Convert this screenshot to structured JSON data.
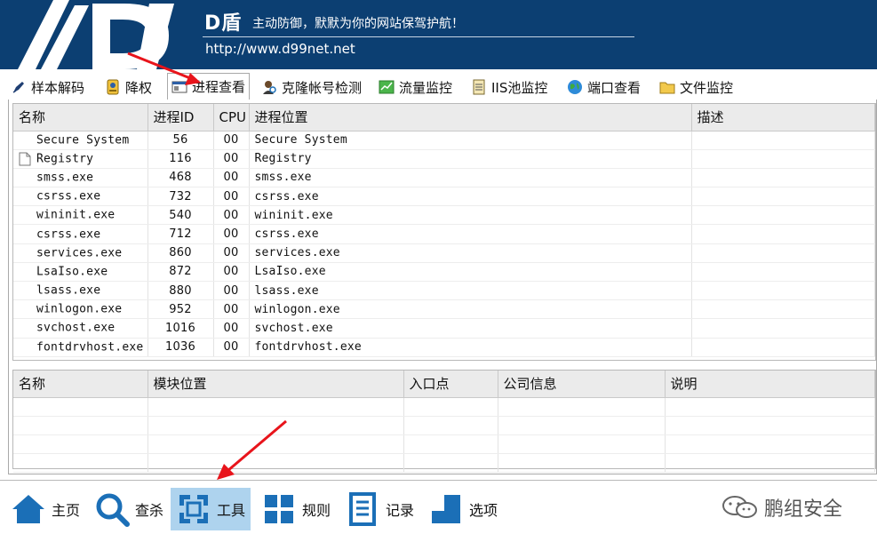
{
  "header": {
    "brand": "D盾",
    "tagline": "主动防御，默默为你的网站保驾护航！",
    "url": "http://www.d99net.net"
  },
  "tabs": [
    {
      "label": "样本解码",
      "icon": "pen-icon"
    },
    {
      "label": "降权",
      "icon": "badge-icon"
    },
    {
      "label": "进程查看",
      "icon": "process-window-icon",
      "active": true
    },
    {
      "label": "克隆帐号检测",
      "icon": "user-detect-icon"
    },
    {
      "label": "流量监控",
      "icon": "traffic-chart-icon"
    },
    {
      "label": "IIS池监控",
      "icon": "document-list-icon"
    },
    {
      "label": "端口查看",
      "icon": "globe-icon"
    },
    {
      "label": "文件监控",
      "icon": "folder-icon"
    }
  ],
  "process_table": {
    "columns": [
      "名称",
      "进程ID",
      "CPU",
      "进程位置",
      "描述"
    ],
    "rows": [
      {
        "name": "Secure System",
        "pid": "56",
        "cpu": "00",
        "path": "Secure System",
        "desc": ""
      },
      {
        "name": "Registry",
        "pid": "116",
        "cpu": "00",
        "path": "Registry",
        "desc": ""
      },
      {
        "name": "smss.exe",
        "pid": "468",
        "cpu": "00",
        "path": "smss.exe",
        "desc": ""
      },
      {
        "name": "csrss.exe",
        "pid": "732",
        "cpu": "00",
        "path": "csrss.exe",
        "desc": ""
      },
      {
        "name": "wininit.exe",
        "pid": "540",
        "cpu": "00",
        "path": "wininit.exe",
        "desc": ""
      },
      {
        "name": "csrss.exe",
        "pid": "712",
        "cpu": "00",
        "path": "csrss.exe",
        "desc": ""
      },
      {
        "name": "services.exe",
        "pid": "860",
        "cpu": "00",
        "path": "services.exe",
        "desc": ""
      },
      {
        "name": "LsaIso.exe",
        "pid": "872",
        "cpu": "00",
        "path": "LsaIso.exe",
        "desc": ""
      },
      {
        "name": "lsass.exe",
        "pid": "880",
        "cpu": "00",
        "path": "lsass.exe",
        "desc": ""
      },
      {
        "name": "winlogon.exe",
        "pid": "952",
        "cpu": "00",
        "path": "winlogon.exe",
        "desc": ""
      },
      {
        "name": "svchost.exe",
        "pid": "1016",
        "cpu": "00",
        "path": "svchost.exe",
        "desc": ""
      },
      {
        "name": "fontdrvhost.exe",
        "pid": "1036",
        "cpu": "00",
        "path": "fontdrvhost.exe",
        "desc": ""
      }
    ]
  },
  "module_table": {
    "columns": [
      "名称",
      "模块位置",
      "入口点",
      "公司信息",
      "说明"
    ],
    "empty_rows": 4
  },
  "bottom_nav": [
    {
      "label": "主页",
      "icon": "home-icon"
    },
    {
      "label": "查杀",
      "icon": "search-icon"
    },
    {
      "label": "工具",
      "icon": "tools-icon",
      "active": true
    },
    {
      "label": "规则",
      "icon": "rules-grid-icon"
    },
    {
      "label": "记录",
      "icon": "log-list-icon"
    },
    {
      "label": "选项",
      "icon": "options-icon"
    }
  ],
  "watermark": {
    "text": "鹏组安全",
    "icon": "wechat-icon"
  },
  "colors": {
    "header_bg": "#0c3f72",
    "active_nav": "#aed3ee",
    "nav_icon": "#1b6fb7",
    "annotation_arrow": "#e8141b"
  }
}
